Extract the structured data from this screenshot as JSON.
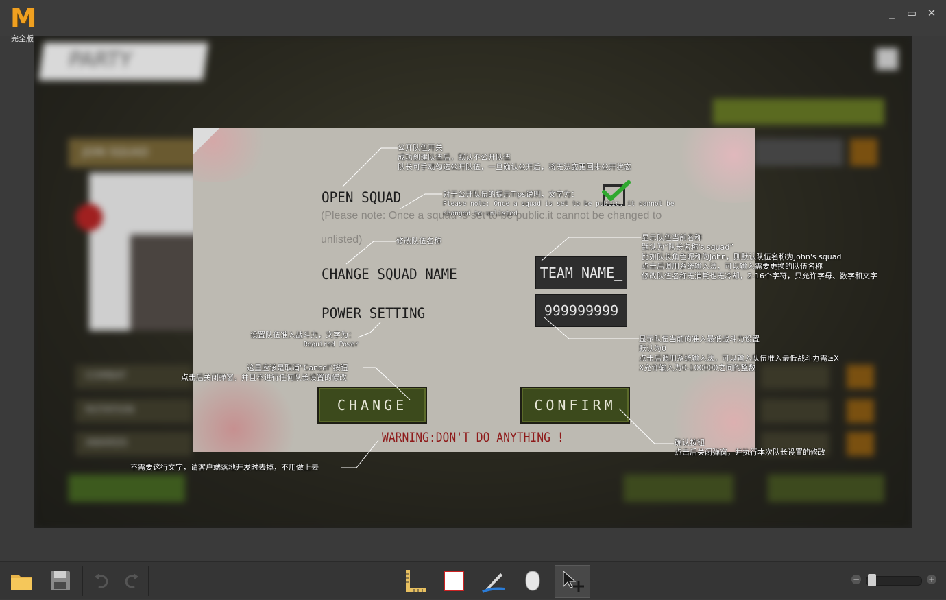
{
  "window": {
    "logo_letter": "M",
    "logo_text": "完全版",
    "controls": [
      "_",
      "▭",
      "✕"
    ]
  },
  "dialog": {
    "open_squad_label": "OPEN SQUAD",
    "open_squad_note_line1": "(Please note: Once a squad is set to be public,it cannot be changed to",
    "open_squad_note_line2": "unlisted)",
    "open_squad_checked": true,
    "change_name_label": "CHANGE SQUAD NAME",
    "team_name_value": "TEAM NAME_",
    "power_setting_label": "POWER SETTING",
    "power_value": "999999999",
    "change_button": "CHANGE",
    "confirm_button": "CONFIRM",
    "warning": "WARNING:DON'T DO ANYTHING !"
  },
  "annotations": {
    "open_squad": [
      "公开队伍开关",
      "成功创建队伍后，默认不公开队伍",
      "队长可手动勾选公开队伍，一旦确认公开后，将无法变更回未公开状态"
    ],
    "tips_title": "对于公开队伍的提示Tips说明，文字为：",
    "tips_text_1": "Please note: Once a squad is set to be public, it cannot be",
    "tips_text_2": "changed to unlisted",
    "change_name": "修改队伍名称",
    "team_name": [
      "显示队伍当前名称",
      "默认为“队长名称's squad”",
      "比如队长角色昵称为John，则默认队伍名称为John's squad",
      "点击后调用系统输入法，可以输入需要更换的队伍名称",
      "修改队伍名称无消耗也无冷却，2-16个字符，只允许字母、数字和文字"
    ],
    "power_setting_title": "设置队伍准入战斗力，文字为：",
    "power_setting_text": "Required  Power",
    "power_value": [
      "显示队伍当前的准入最低战斗力设置",
      "默认为0",
      "点击后调用系统输入法，可以输入队伍准入最低战斗力需≥X",
      "X允许输入为0-100000之间的整数"
    ],
    "change_button_1": "这里应该是取消“Cancel”按钮",
    "change_button_2": "点击后关闭弹窗，并且不进行任何队长设置的修改",
    "confirm_button": [
      "确认按钮",
      "点击后关闭弹窗，并执行本次队长设置的修改"
    ],
    "warning": "不需要这行文字，请客户端落地开发时去掉，不用做上去"
  },
  "background": {
    "title": "PARTY",
    "buttons": [
      "JOIN SQUAD",
      "COMBAT",
      "ROTATION",
      "AWARDS"
    ]
  },
  "toolbar": {
    "tools": [
      "open-folder",
      "save",
      "undo",
      "redo",
      "ruler",
      "rectangle",
      "pen",
      "mouse",
      "move"
    ]
  }
}
